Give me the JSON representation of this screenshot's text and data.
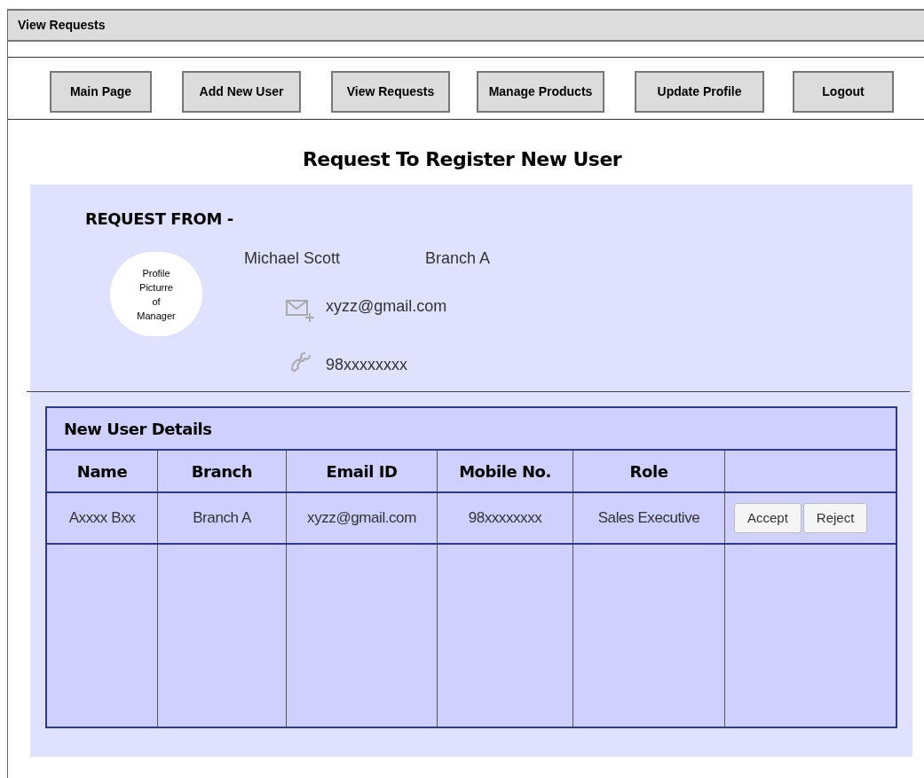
{
  "window": {
    "title": "View Requests"
  },
  "nav": [
    "Main Page",
    "Add New User",
    "View Requests",
    "Manage Products",
    "Update Profile",
    "Logout"
  ],
  "heading": "Request To Register New User",
  "request": {
    "label": "REQUEST FROM -",
    "avatar_text": "Profile Picturre of Manager",
    "name": "Michael Scott",
    "branch": "Branch A",
    "email": "xyzz@gmail.com",
    "phone": "98xxxxxxxx"
  },
  "table": {
    "title": "New User Details",
    "columns": [
      "Name",
      "Branch",
      "Email ID",
      "Mobile No.",
      "Role"
    ],
    "rows": [
      {
        "cells": [
          "Axxxx Bxx",
          "Branch A",
          "xyzz@gmail.com",
          "98xxxxxxxx",
          "Sales Executive"
        ],
        "actions": [
          "Accept",
          "Reject"
        ]
      }
    ]
  }
}
